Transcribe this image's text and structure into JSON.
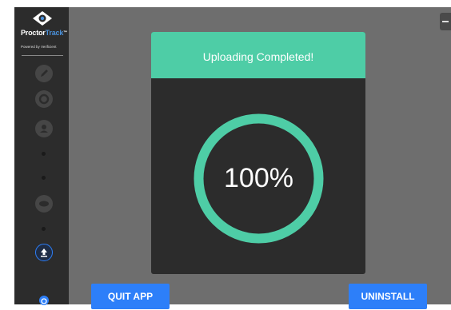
{
  "sidebar": {
    "brand_main": "Proctor",
    "brand_accent": "Track",
    "brand_tm": "™",
    "brand_sub": "Powered by Verificient",
    "nav_icons": [
      "pencil-icon",
      "gear-icon",
      "user-icon",
      "dot",
      "dot",
      "eye-icon",
      "dot",
      "upload-icon"
    ],
    "help_icon": "help-icon"
  },
  "dialog": {
    "title": "Uploading Completed!",
    "progress": 1.0,
    "progress_label": "100%"
  },
  "buttons": {
    "quit": "QUIT APP",
    "uninstall": "UNINSTALL"
  },
  "colors": {
    "accent": "#4ecda6",
    "primary": "#2d7ff9",
    "sidebar_bg": "#2c2c2c",
    "dialog_bg": "#2c2c2c"
  }
}
